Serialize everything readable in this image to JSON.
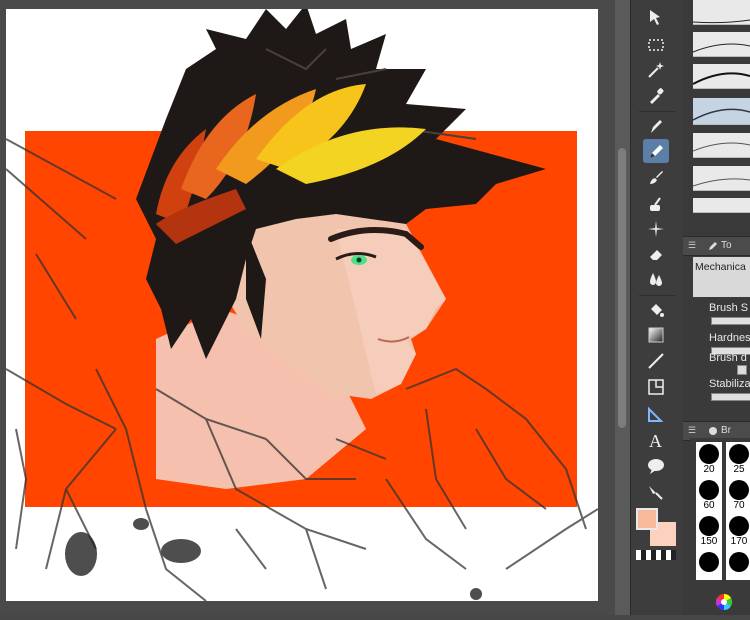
{
  "app": {
    "accent": "#5b7fa6"
  },
  "tools": [
    {
      "name": "move-layer-tool",
      "icon": "move-arrow-icon"
    },
    {
      "name": "rectangle-selection-tool",
      "icon": "dashed-rectangle-icon"
    },
    {
      "name": "auto-select-tool",
      "icon": "magic-wand-icon"
    },
    {
      "name": "eyedropper-tool",
      "icon": "eyedropper-icon"
    },
    {
      "name": "pen-tool",
      "icon": "pen-icon"
    },
    {
      "name": "pencil-tool",
      "icon": "pencil-icon",
      "active": true
    },
    {
      "name": "brush-tool",
      "icon": "brush-icon"
    },
    {
      "name": "airbrush-tool",
      "icon": "airbrush-icon"
    },
    {
      "name": "decoration-tool",
      "icon": "sparkle-icon"
    },
    {
      "name": "eraser-tool",
      "icon": "eraser-icon"
    },
    {
      "name": "blend-tool",
      "icon": "droplet-icon"
    },
    {
      "name": "fill-tool",
      "icon": "bucket-icon"
    },
    {
      "name": "gradient-tool",
      "icon": "gradient-icon"
    },
    {
      "name": "figure-tool",
      "icon": "line-icon"
    },
    {
      "name": "frame-border-tool",
      "icon": "frame-icon"
    },
    {
      "name": "ruler-tool",
      "icon": "ruler-icon"
    },
    {
      "name": "text-tool",
      "icon": "text-a-icon"
    },
    {
      "name": "balloon-tool",
      "icon": "speech-balloon-icon"
    },
    {
      "name": "correct-line-tool",
      "icon": "correct-line-icon"
    }
  ],
  "colors": {
    "main": "#f7b99a",
    "sub": "#fcd2be"
  },
  "sub_tool_panel": {
    "title": "To",
    "name": "Mechanica"
  },
  "tool_property": {
    "brush_size_label": "Brush S",
    "hardness_label": "Hardnes",
    "brush_density_label": "Brush d",
    "stabilization_label": "Stabiliza"
  },
  "brush_size_panel": {
    "title": "Br",
    "sizes": [
      "20",
      "25",
      "60",
      "70",
      "150",
      "170"
    ]
  },
  "canvas": {
    "background_color": "#ff4500"
  }
}
